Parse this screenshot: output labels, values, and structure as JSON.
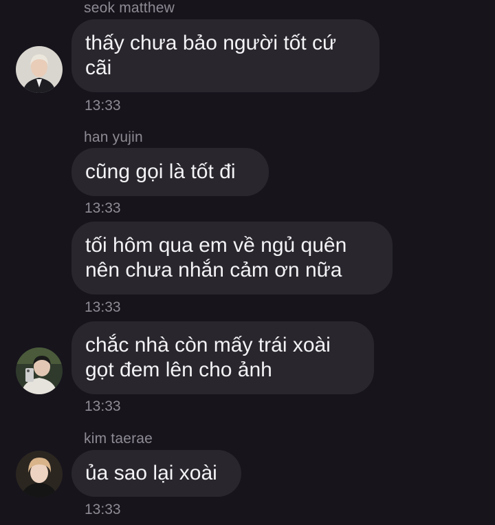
{
  "messages": [
    {
      "sender": "seok matthew",
      "lines": [
        "thấy chưa bảo người tốt cứ",
        "cãi"
      ],
      "time": "13:33"
    },
    {
      "sender": "han yujin",
      "lines": [
        "cũng gọi là tốt đi"
      ],
      "time": "13:33"
    },
    {
      "lines": [
        "tối hôm qua em về ngủ quên",
        "nên chưa nhắn cảm ơn nữa"
      ],
      "time": "13:33"
    },
    {
      "lines": [
        "chắc nhà còn mấy trái xoài",
        "gọt đem lên cho ảnh"
      ],
      "time": "13:33"
    },
    {
      "sender": "kim taerae",
      "lines": [
        "ủa sao lại xoài"
      ],
      "time": "13:33"
    }
  ],
  "avatars": [
    {
      "icon": "avatar-seok-matthew"
    },
    {
      "icon": "avatar-han-yujin"
    },
    {
      "icon": "avatar-kim-taerae"
    }
  ],
  "colors": {
    "background": "#17141c",
    "bubble": "#29272d",
    "meta_text": "#8e8b94",
    "message_text": "#f3f2f5"
  }
}
